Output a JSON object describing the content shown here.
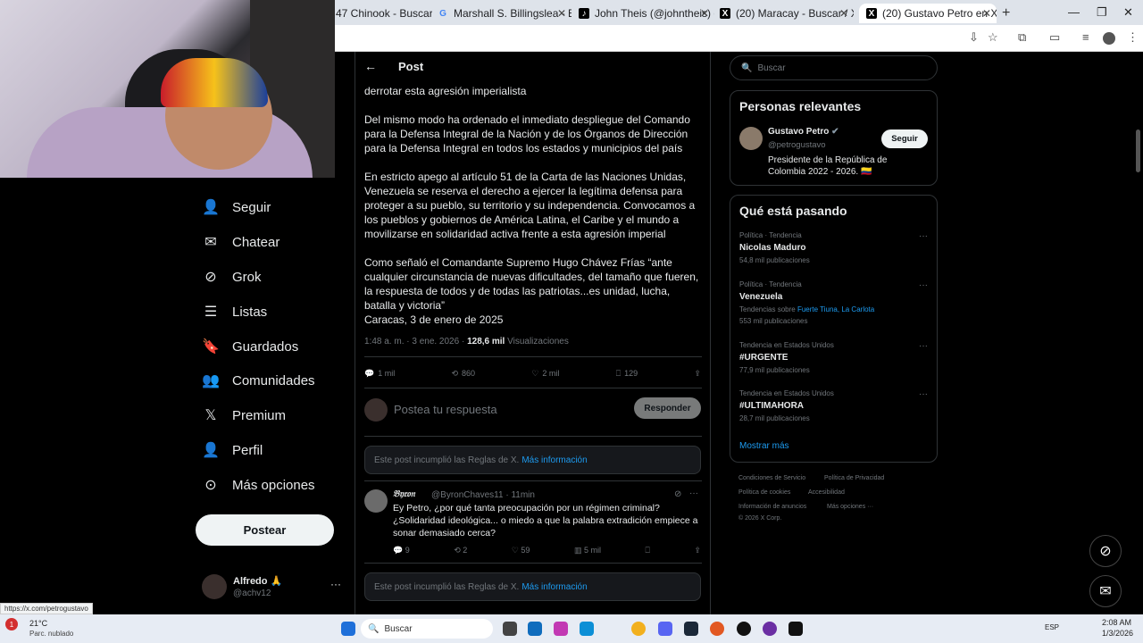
{
  "browser": {
    "tabs": [
      {
        "label": "47 Chinook - Buscar co",
        "favicon": "x"
      },
      {
        "label": "Marshall S. Billingslea - Buscar",
        "favicon": "google"
      },
      {
        "label": "John Theis (@johntheis) está LI",
        "favicon": "tiktok"
      },
      {
        "label": "(20) Maracay - Buscar / X",
        "favicon": "x"
      },
      {
        "label": "(20) Gustavo Petro en X: \"Este",
        "favicon": "x"
      }
    ],
    "status_url": "https://x.com/petrogustavo"
  },
  "nav": {
    "items": [
      {
        "label": "Seguir",
        "icon": "add-user-icon"
      },
      {
        "label": "Chatear",
        "icon": "mail-icon"
      },
      {
        "label": "Grok",
        "icon": "grok-icon"
      },
      {
        "label": "Listas",
        "icon": "list-icon"
      },
      {
        "label": "Guardados",
        "icon": "bookmark-icon"
      },
      {
        "label": "Comunidades",
        "icon": "communities-icon"
      },
      {
        "label": "Premium",
        "icon": "x-logo-icon"
      },
      {
        "label": "Perfil",
        "icon": "profile-icon"
      },
      {
        "label": "Más opciones",
        "icon": "more-options-icon"
      }
    ],
    "post_button": "Postear",
    "user": {
      "name": "Alfredo 🙏",
      "handle": "@achv12"
    }
  },
  "post": {
    "header": "Post",
    "paragraphs": [
      "derrotar esta agresión imperialista",
      "Del mismo modo ha ordenado el inmediato despliegue del Comando para la Defensa Integral de la Nación y de los Órganos de Dirección para la Defensa Integral en todos los estados y municipios del país",
      "En estricto apego al artículo 51 de la Carta de las Naciones Unidas, Venezuela se reserva el derecho a ejercer la legítima defensa para proteger a su pueblo, su territorio y su independencia. Convocamos a los pueblos y gobiernos de América Latina, el Caribe y el mundo a movilizarse en solidaridad activa frente a esta agresión imperial",
      "Como señaló el Comandante Supremo Hugo Chávez Frías “ante cualquier circunstancia de nuevas dificultades, del tamaño que fueren, la respuesta de todos y de todas las patriotas...es unidad, lucha, batalla y victoria”",
      "Caracas, 3 de enero de 2025"
    ],
    "time": "1:48 a. m. · 3 ene. 2026 ·",
    "views_count": "128,6 mil",
    "views_label": "Visualizaciones",
    "stats": {
      "replies": "1 mil",
      "reposts": "860",
      "likes": "2 mil",
      "bookmarks": "129"
    },
    "reply_placeholder": "Postea tu respuesta",
    "reply_button": "Responder"
  },
  "notice": {
    "text": "Este post incumplió las Reglas de X.",
    "link": "Más información"
  },
  "reply": {
    "name": "𝔅𝔶𝔯𝔬𝔫",
    "handle": "@ByronChaves11 · 11min",
    "text": "Ey Petro, ¿por qué tanta preocupación por un régimen criminal? ¿Solidaridad ideológica... o miedo a que la palabra extradición empiece a sonar demasiado cerca?",
    "stats": {
      "replies": "9",
      "reposts": "2",
      "likes": "59",
      "views": "5 mil"
    }
  },
  "right": {
    "search_placeholder": "Buscar",
    "relevant_title": "Personas relevantes",
    "person": {
      "name": "Gustavo Petro",
      "handle": "@petrogustavo",
      "bio": "Presidente de la República de Colombia 2022 - 2026. 🇨🇴",
      "follow": "Seguir"
    },
    "trends_title": "Qué está pasando",
    "trends": [
      {
        "category": "Política · Tendencia",
        "name": "Nicolas Maduro",
        "count": "54,8 mil publicaciones"
      },
      {
        "category": "Política · Tendencia",
        "name": "Venezuela",
        "related_prefix": "Tendencias sobre",
        "related": "Fuerte Tiuna, La Carlota",
        "count": "553 mil publicaciones"
      },
      {
        "category": "Tendencia en Estados Unidos",
        "name": "#URGENTE",
        "count": "77,9 mil publicaciones"
      },
      {
        "category": "Tendencia en Estados Unidos",
        "name": "#ULTIMAHORA",
        "count": "28,7 mil publicaciones"
      }
    ],
    "show_more": "Mostrar más",
    "footer": [
      "Condiciones de Servicio",
      "Política de Privacidad",
      "Política de cookies",
      "Accesibilidad",
      "Información de anuncios",
      "Más opciones ···",
      "© 2026 X Corp."
    ]
  },
  "taskbar": {
    "weather_temp": "21°C",
    "weather_desc": "Parc. nublado",
    "search": "Buscar",
    "lang": "ESP",
    "time": "2:08 AM",
    "date": "1/3/2026"
  },
  "colors": {
    "accent": "#1d9bf0",
    "background": "#000000",
    "border": "#2f3336",
    "muted": "#71767b"
  }
}
